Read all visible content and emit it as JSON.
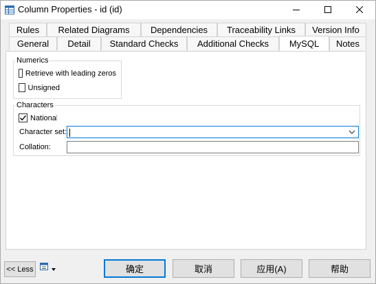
{
  "window": {
    "title": "Column Properties - id (id)",
    "icon": "table-properties-icon",
    "controls": [
      "minimize-icon",
      "maximize-icon",
      "close-icon"
    ]
  },
  "tabs": {
    "row1": [
      "Rules",
      "Related Diagrams",
      "Dependencies",
      "Traceability Links",
      "Version Info"
    ],
    "row2": [
      "General",
      "Detail",
      "Standard Checks",
      "Additional Checks",
      "MySQL",
      "Notes"
    ],
    "active": "MySQL"
  },
  "numerics": {
    "title": "Numerics",
    "retrieve_zeros_label": "Retrieve with leading zeros",
    "retrieve_zeros_checked": false,
    "unsigned_label": "Unsigned",
    "unsigned_checked": false
  },
  "characters": {
    "title": "Characters",
    "national_label": "National",
    "national_checked": true,
    "charset_label": "Character set:",
    "charset_value": "",
    "collation_label": "Collation:",
    "collation_value": ""
  },
  "footer": {
    "less_label": "<< Less",
    "ok_label": "确定",
    "cancel_label": "取消",
    "apply_label": "应用(A)",
    "help_label": "帮助"
  },
  "colors": {
    "accent": "#0078d7",
    "dialog_bg": "#f0f0f0",
    "button_bg": "#e1e1e1"
  }
}
